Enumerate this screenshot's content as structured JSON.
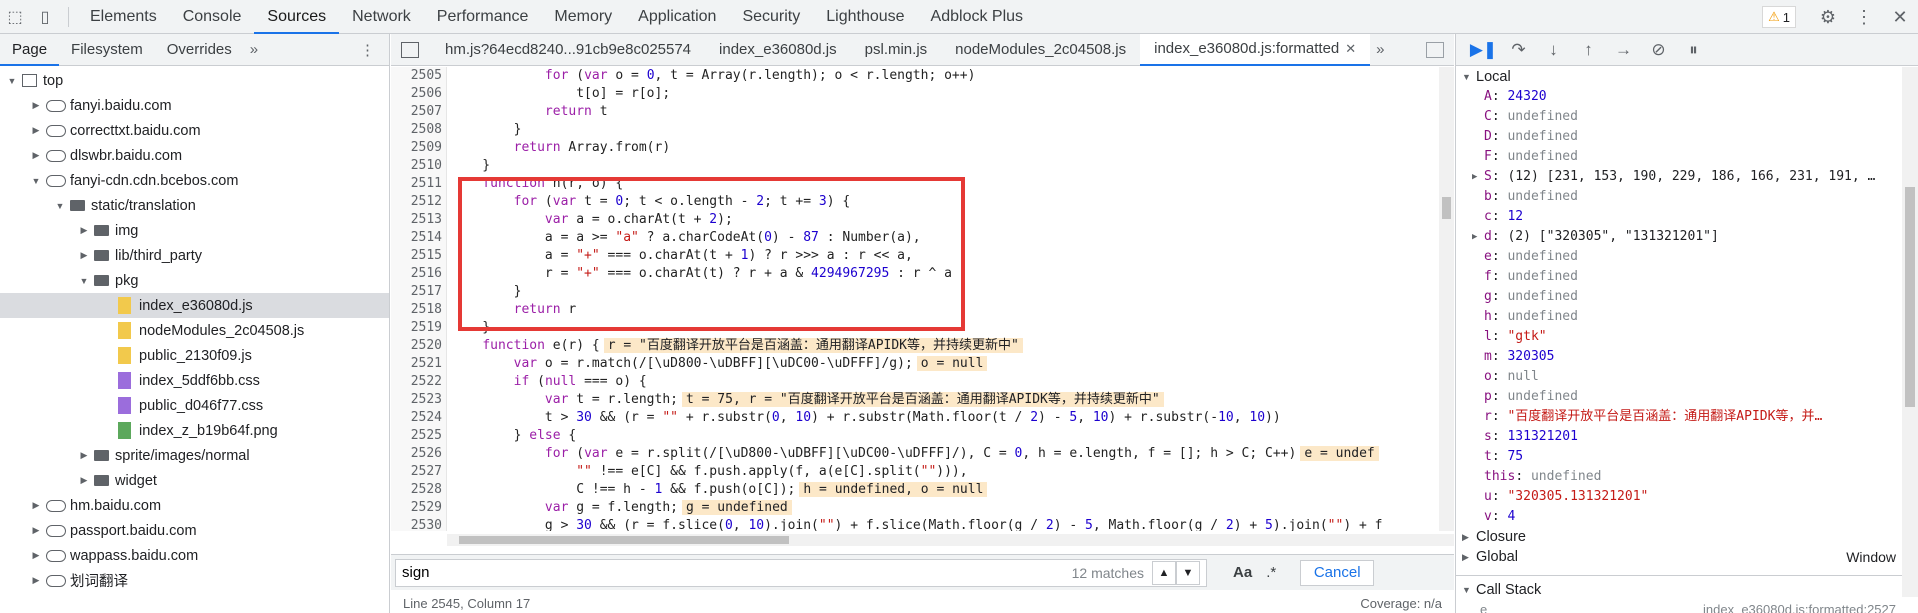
{
  "topbar": {
    "tabs": [
      "Elements",
      "Console",
      "Sources",
      "Network",
      "Performance",
      "Memory",
      "Application",
      "Security",
      "Lighthouse",
      "Adblock Plus"
    ],
    "active_tab": "Sources",
    "warning_count": "1"
  },
  "navigator": {
    "tabs": [
      "Page",
      "Filesystem",
      "Overrides"
    ],
    "more": "»",
    "tree": [
      {
        "label": "top",
        "depth": 0,
        "icon": "frame",
        "expanded": true
      },
      {
        "label": "fanyi.baidu.com",
        "depth": 1,
        "icon": "cloud",
        "expanded": false
      },
      {
        "label": "correcttxt.baidu.com",
        "depth": 1,
        "icon": "cloud",
        "expanded": false
      },
      {
        "label": "dlswbr.baidu.com",
        "depth": 1,
        "icon": "cloud",
        "expanded": false
      },
      {
        "label": "fanyi-cdn.cdn.bcebos.com",
        "depth": 1,
        "icon": "cloud",
        "expanded": true
      },
      {
        "label": "static/translation",
        "depth": 2,
        "icon": "folder",
        "expanded": true
      },
      {
        "label": "img",
        "depth": 3,
        "icon": "folder",
        "expanded": false
      },
      {
        "label": "lib/third_party",
        "depth": 3,
        "icon": "folder",
        "expanded": false
      },
      {
        "label": "pkg",
        "depth": 3,
        "icon": "folder",
        "expanded": true
      },
      {
        "label": "index_e36080d.js",
        "depth": 4,
        "icon": "js",
        "selected": true
      },
      {
        "label": "nodeModules_2c04508.js",
        "depth": 4,
        "icon": "js"
      },
      {
        "label": "public_2130f09.js",
        "depth": 4,
        "icon": "js"
      },
      {
        "label": "index_5ddf6bb.css",
        "depth": 4,
        "icon": "css"
      },
      {
        "label": "public_d046f77.css",
        "depth": 4,
        "icon": "css"
      },
      {
        "label": "index_z_b19b64f.png",
        "depth": 4,
        "icon": "png"
      },
      {
        "label": "sprite/images/normal",
        "depth": 3,
        "icon": "folder",
        "expanded": false
      },
      {
        "label": "widget",
        "depth": 3,
        "icon": "folder",
        "expanded": false
      },
      {
        "label": "hm.baidu.com",
        "depth": 1,
        "icon": "cloud",
        "expanded": false
      },
      {
        "label": "passport.baidu.com",
        "depth": 1,
        "icon": "cloud",
        "expanded": false
      },
      {
        "label": "wappass.baidu.com",
        "depth": 1,
        "icon": "cloud",
        "expanded": false
      },
      {
        "label": "划词翻译",
        "depth": 1,
        "icon": "cloud",
        "expanded": false
      }
    ]
  },
  "editor": {
    "tabs": [
      "hm.js?64ecd8240...91cb9e8c025574",
      "index_e36080d.js",
      "psl.min.js",
      "nodeModules_2c04508.js",
      "index_e36080d.js:formatted"
    ],
    "active_tab": "index_e36080d.js:formatted",
    "more": "»",
    "line_numbers": [
      "2505",
      "2506",
      "2507",
      "2508",
      "2509",
      "2510",
      "2511",
      "2512",
      "2513",
      "2514",
      "2515",
      "2516",
      "2517",
      "2518",
      "2519",
      "2520",
      "2521",
      "2522",
      "2523",
      "2524",
      "2525",
      "2526",
      "2527",
      "2528",
      "2529",
      "2530"
    ],
    "lines": [
      "            for (var o = 0, t = Array(r.length); o < r.length; o++)",
      "                t[o] = r[o];",
      "            return t",
      "        }",
      "        return Array.from(r)",
      "    }",
      "    function n(r, o) {",
      "        for (var t = 0; t < o.length - 2; t += 3) {",
      "            var a = o.charAt(t + 2);",
      "            a = a >= \"a\" ? a.charCodeAt(0) - 87 : Number(a),",
      "            a = \"+\" === o.charAt(t + 1) ? r >>> a : r << a,",
      "            r = \"+\" === o.charAt(t) ? r + a & 4294967295 : r ^ a",
      "        }",
      "        return r",
      "    }",
      "    function e(r) {",
      "        var o = r.match(/[\\uD800-\\uDBFF][\\uDC00-\\uDFFF]/g);",
      "        if (null === o) {",
      "            var t = r.length;",
      "            t > 30 && (r = \"\" + r.substr(0, 10) + r.substr(Math.floor(t / 2) - 5, 10) + r.substr(-10, 10))",
      "        } else {",
      "            for (var e = r.split(/[\\uD800-\\uDBFF][\\uDC00-\\uDFFF]/), C = 0, h = e.length, f = []; h > C; C++)",
      "                \"\" !== e[C] && f.push.apply(f, a(e[C].split(\"\"))),",
      "                C !== h - 1 && f.push(o[C]);",
      "            var g = f.length;",
      "            g > 30 && (r = f.slice(0, 10).join(\"\") + f.slice(Math.floor(g / 2) - 5, Math.floor(g / 2) + 5).join(\"\") + f"
    ],
    "annotations": {
      "2520": "r = \"百度翻译开放平台是百涵盖：通用翻译APIDK等，并持续更新中\"",
      "2521": "o = null",
      "2523": "t = 75, r = \"百度翻译开放平台是百涵盖：通用翻译APIDK等，并持续更新中\"",
      "2526": "e = undef",
      "2528": "h = undefined, o = null",
      "2529": "g = undefined"
    },
    "search": {
      "value": "sign",
      "count": "12 matches",
      "aa": "Aa",
      "regex": ".*",
      "cancel": "Cancel"
    },
    "status": {
      "position": "Line 2545, Column 17",
      "coverage": "Coverage: n/a"
    }
  },
  "debugger": {
    "sections": {
      "local": "Local",
      "closure": "Closure",
      "global": "Global",
      "global_value": "Window",
      "callstack": "Call Stack"
    },
    "locals": [
      {
        "name": "A",
        "value": "24320",
        "kind": "num"
      },
      {
        "name": "C",
        "value": "undefined",
        "kind": "und"
      },
      {
        "name": "D",
        "value": "undefined",
        "kind": "und"
      },
      {
        "name": "F",
        "value": "undefined",
        "kind": "und"
      },
      {
        "name": "S",
        "value": "(12) [231, 153, 190, 229, 186, 166, 231, 191, …",
        "kind": "obj",
        "expandable": true
      },
      {
        "name": "b",
        "value": "undefined",
        "kind": "und"
      },
      {
        "name": "c",
        "value": "12",
        "kind": "num"
      },
      {
        "name": "d",
        "value": "(2) [\"320305\", \"131321201\"]",
        "kind": "obj",
        "expandable": true
      },
      {
        "name": "e",
        "value": "undefined",
        "kind": "und"
      },
      {
        "name": "f",
        "value": "undefined",
        "kind": "und"
      },
      {
        "name": "g",
        "value": "undefined",
        "kind": "und"
      },
      {
        "name": "h",
        "value": "undefined",
        "kind": "und"
      },
      {
        "name": "l",
        "value": "\"gtk\"",
        "kind": "str"
      },
      {
        "name": "m",
        "value": "320305",
        "kind": "num"
      },
      {
        "name": "o",
        "value": "null",
        "kind": "null"
      },
      {
        "name": "p",
        "value": "undefined",
        "kind": "und"
      },
      {
        "name": "r",
        "value": "\"百度翻译开放平台是百涵盖：通用翻译APIDK等，并…",
        "kind": "str"
      },
      {
        "name": "s",
        "value": "131321201",
        "kind": "num"
      },
      {
        "name": "t",
        "value": "75",
        "kind": "num"
      },
      {
        "name": "this",
        "value": "undefined",
        "kind": "und"
      },
      {
        "name": "u",
        "value": "\"320305.131321201\"",
        "kind": "str"
      },
      {
        "name": "v",
        "value": "4",
        "kind": "num"
      }
    ],
    "callstack_top": {
      "name": "e",
      "location": "index_e36080d.js:formatted:2527"
    }
  }
}
